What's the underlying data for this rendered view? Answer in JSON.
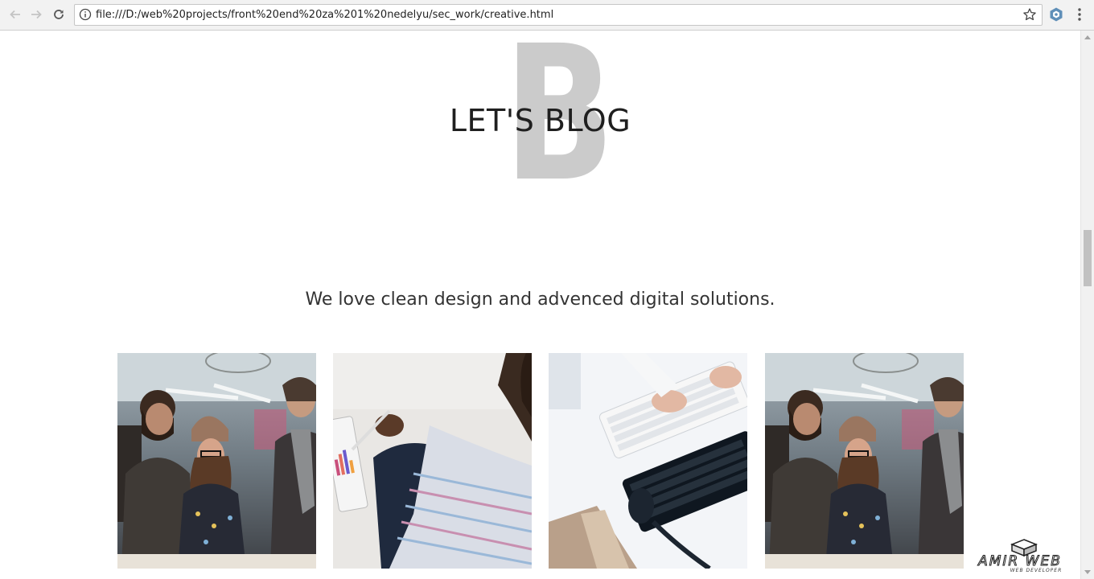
{
  "browser": {
    "url": "file:///D:/web%20projects/front%20end%20za%201%20nedelyu/sec_work/creative.html",
    "icons": {
      "back": "arrow-left-icon",
      "forward": "arrow-right-icon",
      "reload": "reload-icon",
      "info": "info-icon",
      "bookmark": "star-icon",
      "extension": "extension-icon",
      "menu": "kebab-menu-icon"
    }
  },
  "section": {
    "background_letter": "B",
    "title": "LET'S BLOG",
    "subtitle": "We love clean design and advenced digital solutions."
  },
  "gallery": {
    "items": [
      {
        "alt": "team-photo"
      },
      {
        "alt": "tablet-chart-photo"
      },
      {
        "alt": "keyboard-desk-photo"
      },
      {
        "alt": "team-photo"
      }
    ]
  },
  "watermark": {
    "brand": "AMIR WEB",
    "tagline": "WEB DEVELOPER"
  },
  "colors": {
    "background": "#ffffff",
    "heading": "#1f1f1f",
    "ghost_letter": "#cbcbcb",
    "subtitle": "#333333"
  }
}
